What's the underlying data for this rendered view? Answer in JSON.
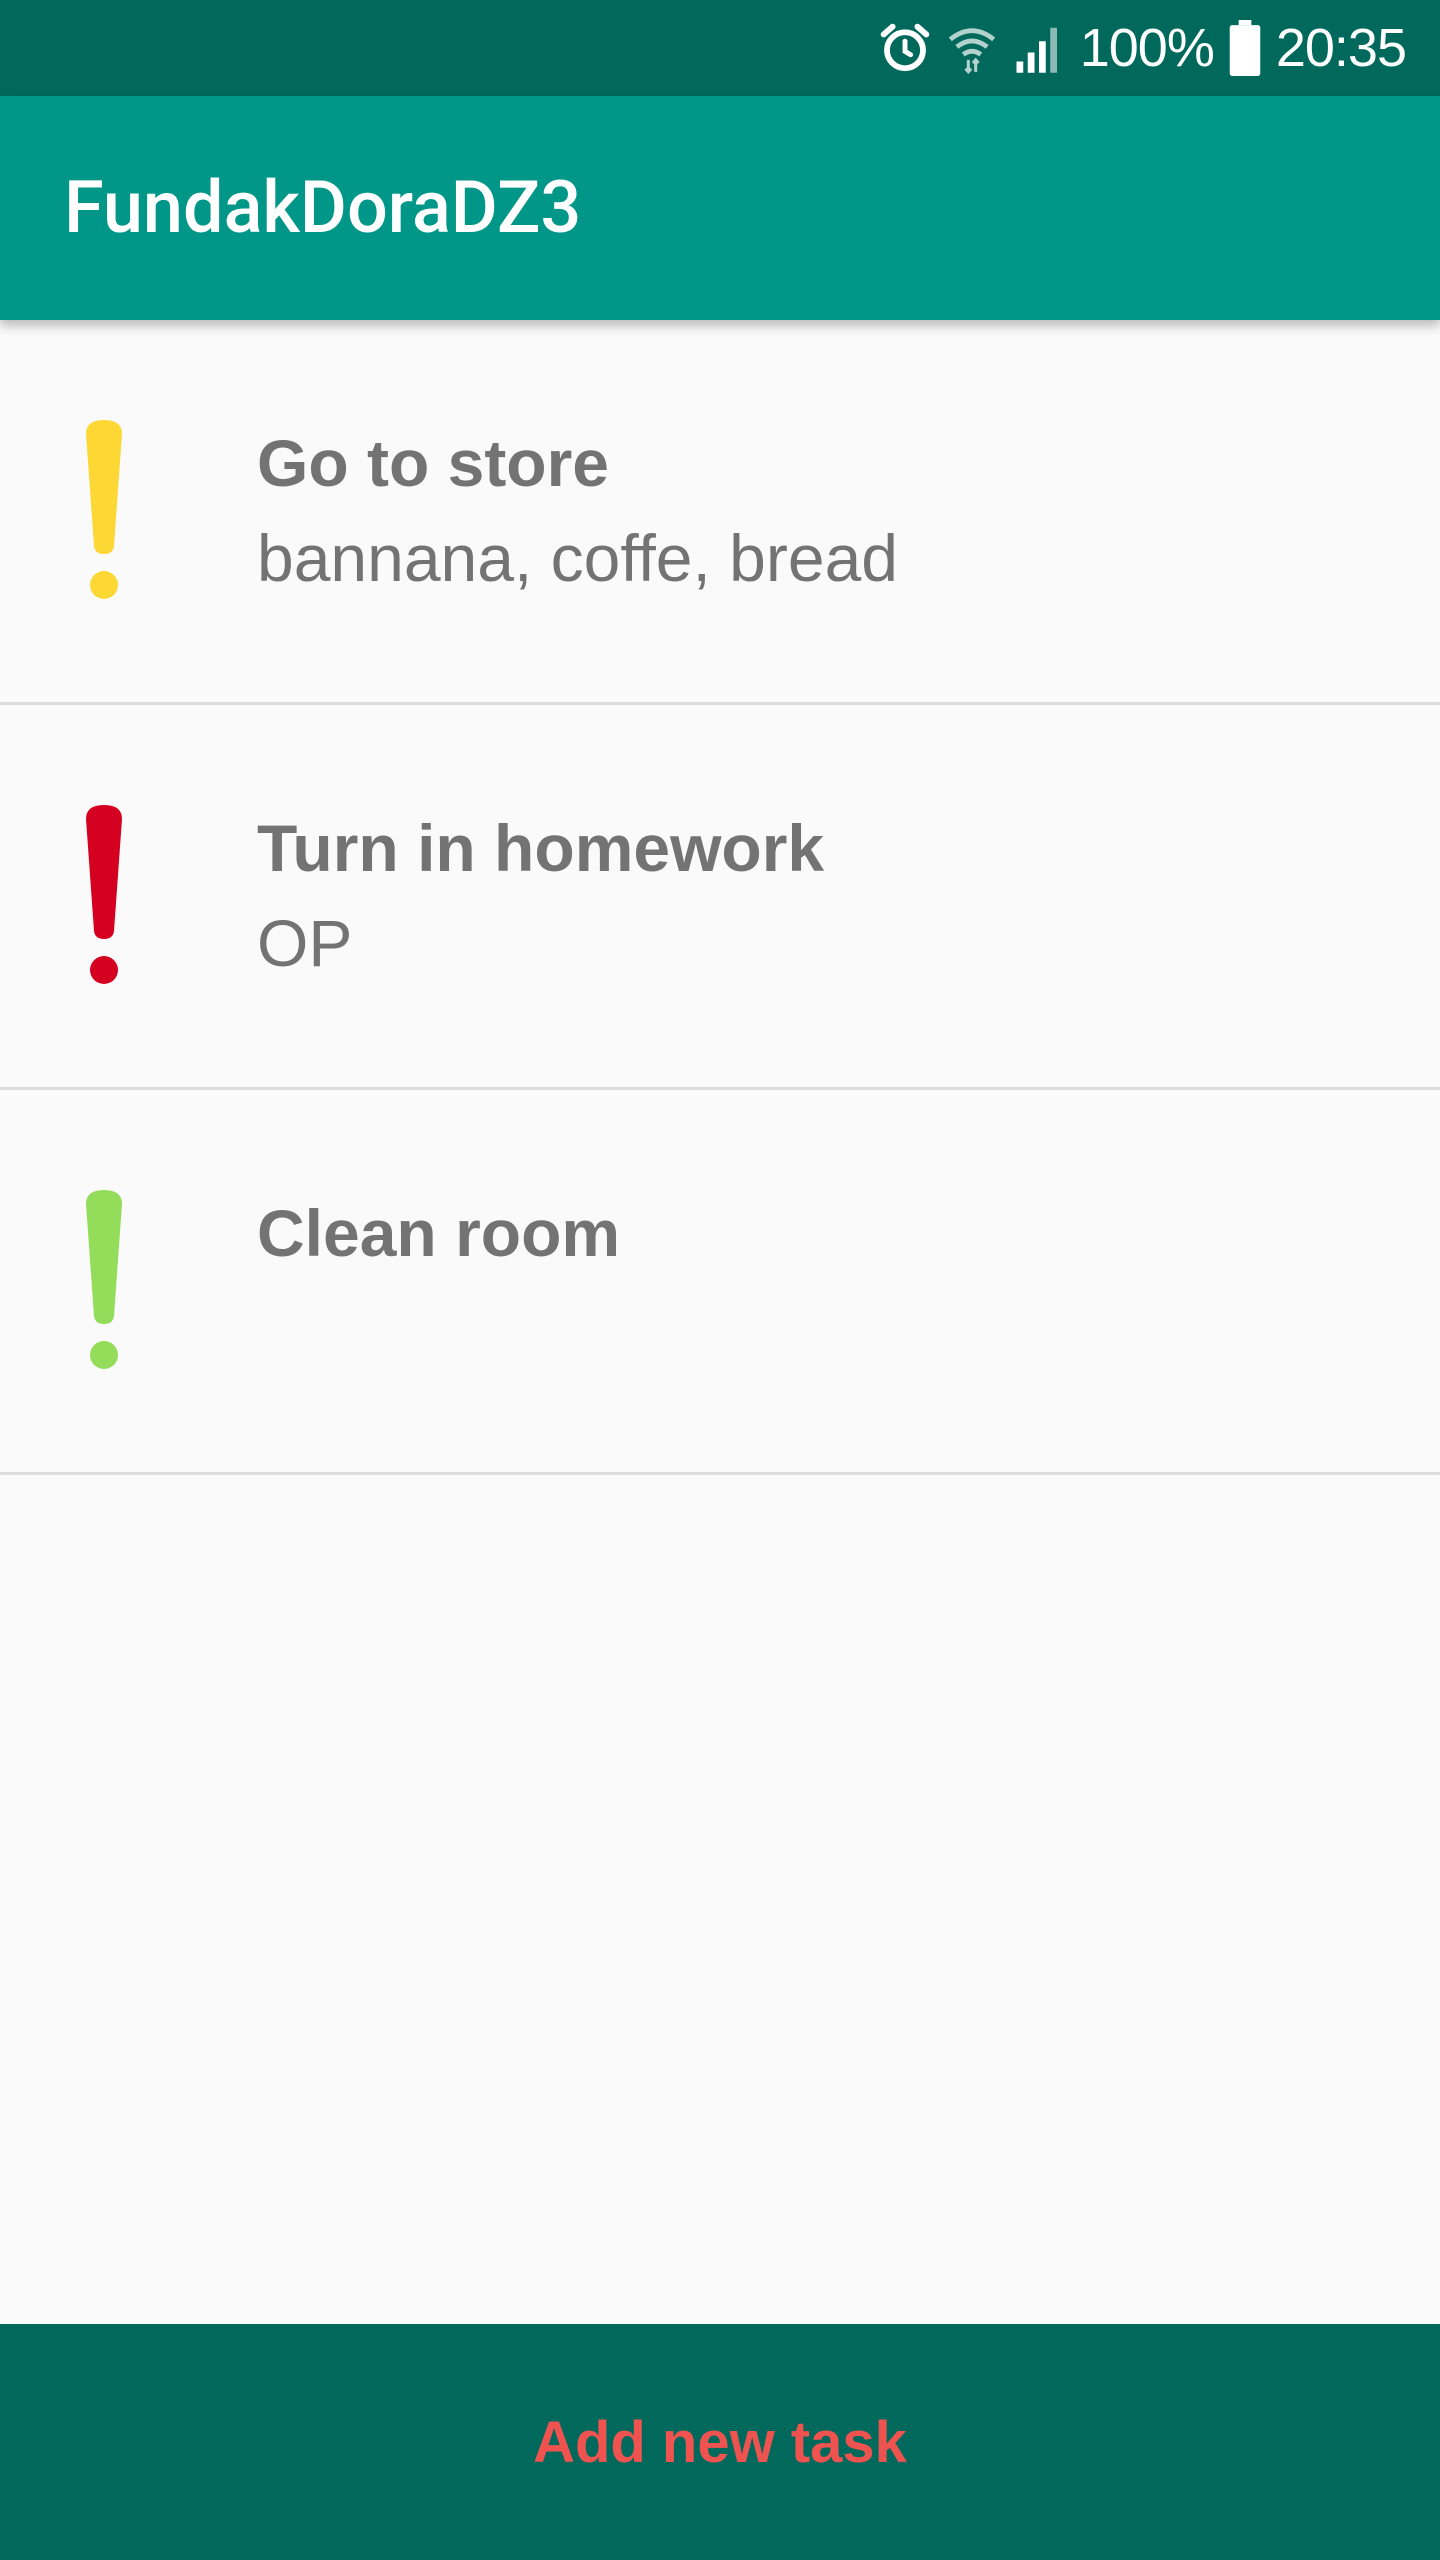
{
  "status_bar": {
    "battery_text": "100%",
    "time": "20:35",
    "icons": [
      "alarm-icon",
      "wifi-icon",
      "cellular-signal-icon",
      "battery-icon"
    ]
  },
  "app_bar": {
    "title": "FundakDoraDZ3"
  },
  "tasks": [
    {
      "title": "Go to store",
      "description": "bannana, coffe, bread",
      "priority_icon": "exclamation-icon",
      "priority_color": "#fdd835"
    },
    {
      "title": "Turn in homework",
      "description": "OP",
      "priority_icon": "exclamation-icon",
      "priority_color": "#d50020"
    },
    {
      "title": "Clean room",
      "description": "",
      "priority_icon": "exclamation-icon",
      "priority_color": "#94dd5a"
    }
  ],
  "footer": {
    "add_button_label": "Add new task"
  },
  "colors": {
    "status_bar": "#00695c",
    "app_bar": "#009688",
    "footer": "#00695c",
    "accent_text": "#ef5350",
    "task_text": "#737373"
  }
}
